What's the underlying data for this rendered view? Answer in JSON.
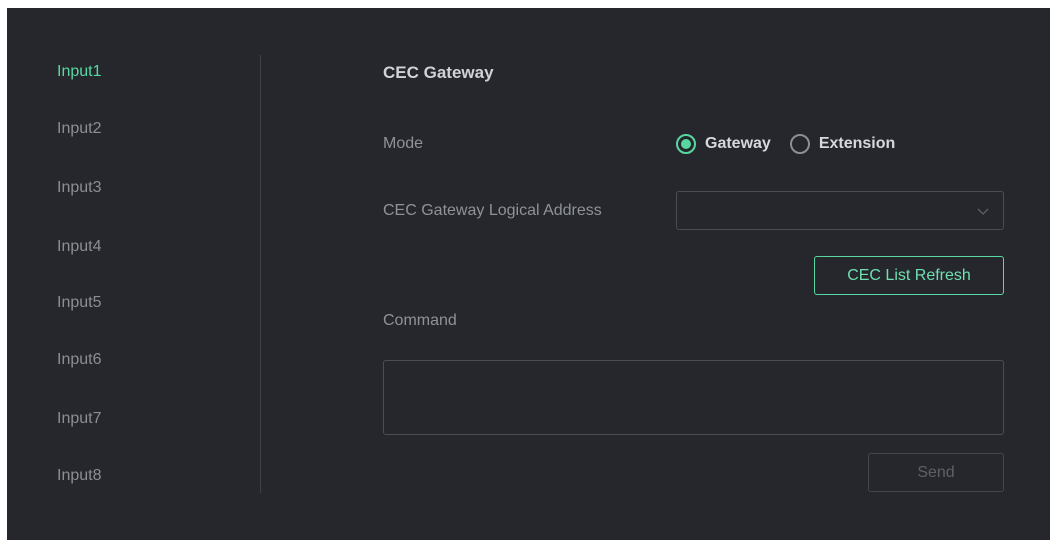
{
  "sidebar": {
    "items": [
      {
        "label": "Input1",
        "active": true
      },
      {
        "label": "Input2"
      },
      {
        "label": "Input3"
      },
      {
        "label": "Input4"
      },
      {
        "label": "Input5"
      },
      {
        "label": "Input6"
      },
      {
        "label": "Input7"
      },
      {
        "label": "Input8"
      }
    ]
  },
  "main": {
    "title": "CEC Gateway",
    "mode": {
      "label": "Mode",
      "options": [
        {
          "label": "Gateway",
          "checked": true
        },
        {
          "label": "Extension",
          "checked": false
        }
      ]
    },
    "logical_address": {
      "label": "CEC Gateway Logical Address",
      "value": ""
    },
    "refresh_button": "CEC List Refresh",
    "command": {
      "label": "Command",
      "value": ""
    },
    "send_button": "Send"
  },
  "colors": {
    "panel_bg": "#25272d",
    "accent": "#57d8a0",
    "text_muted": "#8b8e94"
  }
}
